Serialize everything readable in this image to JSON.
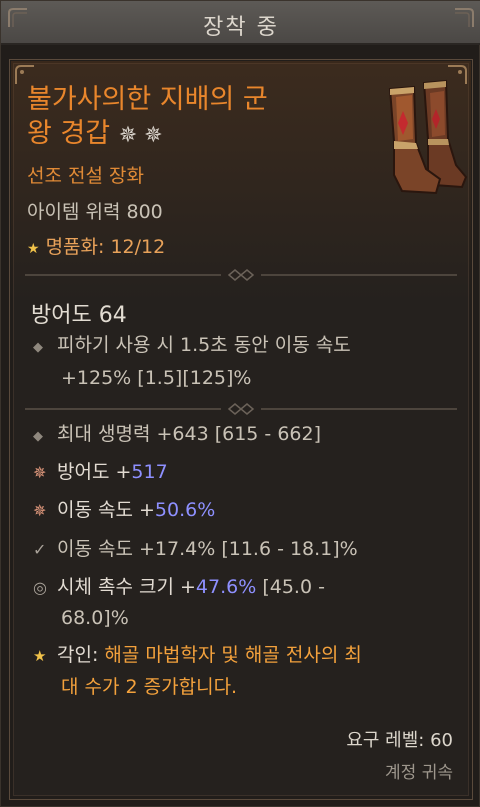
{
  "header": {
    "title": "장착 중"
  },
  "item": {
    "name": "불가사의한 지배의 군 왕 경갑",
    "name_line1": "불가사의한 지배의 군",
    "name_line2": "왕 경갑",
    "gems": "✵ ✵",
    "quality": "선조 전설 장화",
    "item_power": "아이템 위력 800",
    "mastery": "명품화: 12/12",
    "armor": "방어도 64"
  },
  "implicit": {
    "line1": "피하기 사용 시 1.5초 동안 이동 속도",
    "line2": "+125% [1.5][125]%"
  },
  "affixes": [
    {
      "icon": "diamond-bullet-icon",
      "text": "최대 생명력 +643 [615 - 662]"
    },
    {
      "icon": "greater-affix-icon",
      "label": "방어도 +",
      "value": "517"
    },
    {
      "icon": "greater-affix-icon",
      "label": "이동 속도 +",
      "value": "50.6%"
    },
    {
      "icon": "tempered-affix-icon",
      "text": "이동 속도 +17.4% [11.6 - 18.1]%"
    },
    {
      "icon": "tempered-swirl-icon",
      "label": "시체 촉수 크기 +",
      "value": "47.6%",
      "tail": " [45.0 -",
      "line2": "68.0]%"
    },
    {
      "icon": "star-icon",
      "label": "각인: ",
      "text1": "해골 마법학자 및 해골 전사의 최",
      "line2": "대 수가 2 증가합니다."
    }
  ],
  "footer": {
    "required_level": "요구 레벨: 60",
    "account_bound": "계정 귀속"
  },
  "colors": {
    "legendary": "#e9862c",
    "value_blue": "#8e90ff",
    "aspect": "#f3a13c"
  }
}
